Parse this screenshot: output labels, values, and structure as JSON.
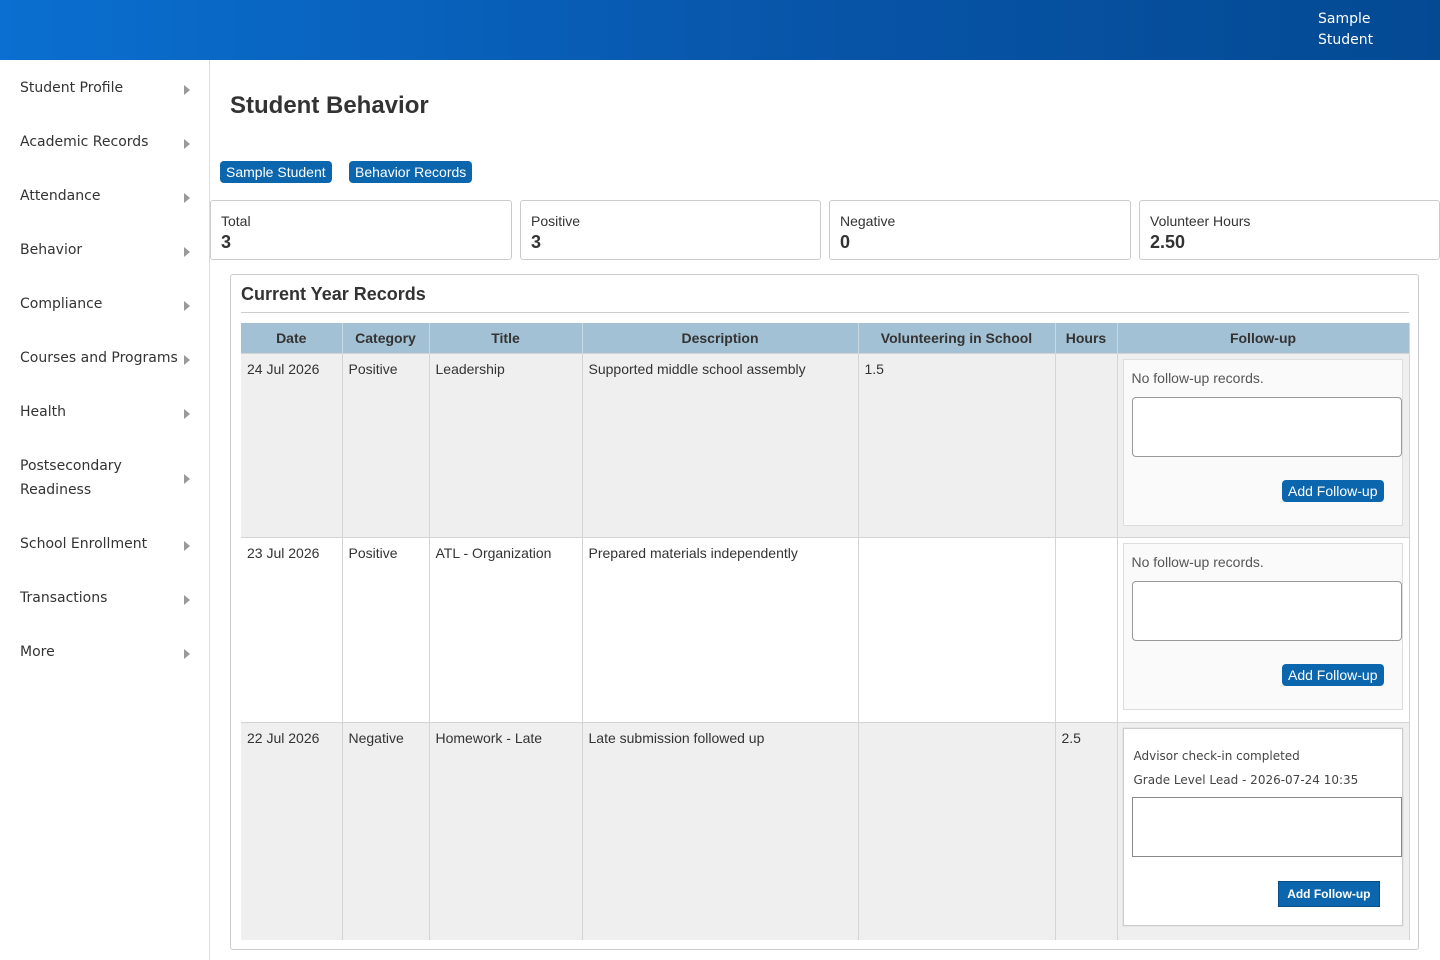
{
  "header": {
    "user": "Sample Student"
  },
  "sidebar": {
    "items": [
      {
        "label": "Student Profile"
      },
      {
        "label": "Academic Records"
      },
      {
        "label": "Attendance"
      },
      {
        "label": "Behavior"
      },
      {
        "label": "Compliance"
      },
      {
        "label": "Courses and Programs"
      },
      {
        "label": "Health"
      },
      {
        "label": "Postsecondary Readiness"
      },
      {
        "label": "School Enrollment"
      },
      {
        "label": "Transactions"
      },
      {
        "label": "More"
      }
    ]
  },
  "page": {
    "title": "Student Behavior",
    "pills": [
      "Sample Student",
      "Behavior Records"
    ]
  },
  "stats": [
    {
      "label": "Total",
      "value": "3"
    },
    {
      "label": "Positive",
      "value": "3"
    },
    {
      "label": "Negative",
      "value": "0"
    },
    {
      "label": "Volunteer Hours",
      "value": "2.50"
    }
  ],
  "records": {
    "title": "Current Year Records",
    "columns": [
      "Date",
      "Category",
      "Title",
      "Description",
      "Volunteering in School",
      "Hours",
      "Follow-up"
    ],
    "rows": [
      {
        "date": "24 Jul 2026",
        "category": "Positive",
        "title": "Leadership",
        "description": "Supported middle school assembly",
        "volunteering": "1.5",
        "hours": "",
        "followup_status": "No follow-up records.",
        "button": "Add Follow-up"
      },
      {
        "date": "23 Jul 2026",
        "category": "Positive",
        "title": "ATL - Organization",
        "description": "Prepared materials independently",
        "volunteering": "",
        "hours": "",
        "followup_status": "No follow-up records.",
        "button": "Add Follow-up"
      },
      {
        "date": "22 Jul 2026",
        "category": "Negative",
        "title": "Homework - Late",
        "description": "Late submission followed up",
        "volunteering": "",
        "hours": "2.5",
        "followup_note": "Advisor check-in completed",
        "followup_meta": "Grade Level Lead - 2026-07-24 10:35",
        "button": "Add Follow-up"
      }
    ]
  }
}
